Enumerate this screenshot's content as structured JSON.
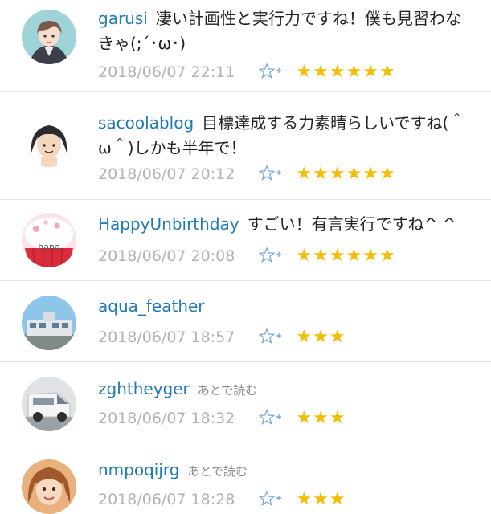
{
  "later_label": "あとで読む",
  "colors": {
    "username": "#1e7bb3",
    "timestamp": "#b3b3b3",
    "star": "#f2be08",
    "divider": "#e2e2e2"
  },
  "comments": [
    {
      "user": "garusi",
      "text": "凄い計画性と実行力ですね！僕も見習わなきゃ(;´･ω･)",
      "date": "2018/06/07 22:11",
      "stars": "★★★★★★",
      "star_count": 6,
      "avatar": "cartoon-character-avatar"
    },
    {
      "user": "sacoolablog",
      "text": "目標達成する力素晴らしいですね(＾ω＾)しかも半年で！",
      "date": "2018/06/07 20:12",
      "stars": "★★★★★★",
      "star_count": 6,
      "avatar": "cartoon-face-avatar"
    },
    {
      "user": "HappyUnbirthday",
      "text": "すごい！有言実行ですね^ ^",
      "date": "2018/06/07 20:08",
      "stars": "★★★★★★",
      "star_count": 6,
      "avatar": "cupcake-avatar",
      "avatar_text": "hana"
    },
    {
      "user": "aqua_feather",
      "text": "",
      "date": "2018/06/07 18:57",
      "stars": "★★★",
      "star_count": 3,
      "avatar": "building-photo-avatar"
    },
    {
      "user": "zghtheyger",
      "text": "",
      "date": "2018/06/07 18:32",
      "stars": "★★★",
      "star_count": 3,
      "avatar": "van-photo-avatar",
      "later": true
    },
    {
      "user": "nmpoqijrg",
      "text": "",
      "date": "2018/06/07 18:28",
      "stars": "★★★",
      "star_count": 3,
      "avatar": "person-photo-avatar",
      "later": true
    }
  ]
}
